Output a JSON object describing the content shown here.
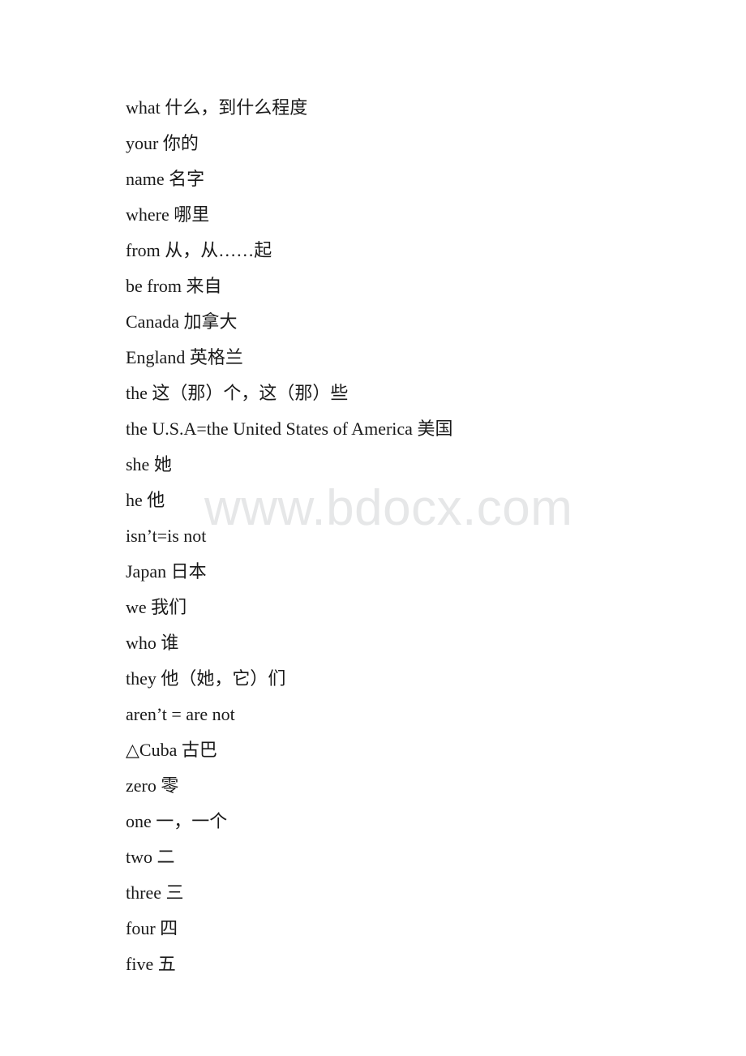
{
  "document": {
    "background_color": "#ffffff",
    "text_color": "#1a1a1a"
  },
  "watermark": {
    "text": "www.bdocx.com",
    "color": "#e6e7e8"
  },
  "vocabulary": {
    "lines": [
      {
        "text": "what 什么，到什么程度"
      },
      {
        "text": "your 你的"
      },
      {
        "text": "name 名字"
      },
      {
        "text": "where 哪里"
      },
      {
        "text": "from 从，从……起"
      },
      {
        "text": "be from 来自"
      },
      {
        "text": "Canada 加拿大"
      },
      {
        "text": "England 英格兰"
      },
      {
        "text": "the 这（那）个，这（那）些"
      },
      {
        "text": "the U.S.A=the United States of America 美国"
      },
      {
        "text": "she 她"
      },
      {
        "text": "he 他"
      },
      {
        "text": "isn’t=is not"
      },
      {
        "text": "Japan 日本"
      },
      {
        "text": "we 我们"
      },
      {
        "text": "who 谁"
      },
      {
        "text": "they 他（她，它）们"
      },
      {
        "text": "aren’t = are not"
      },
      {
        "text": "△Cuba 古巴"
      },
      {
        "text": "zero 零"
      },
      {
        "text": "one 一，一个"
      },
      {
        "text": "two 二"
      },
      {
        "text": "three 三"
      },
      {
        "text": "four 四"
      },
      {
        "text": "five 五"
      }
    ]
  }
}
